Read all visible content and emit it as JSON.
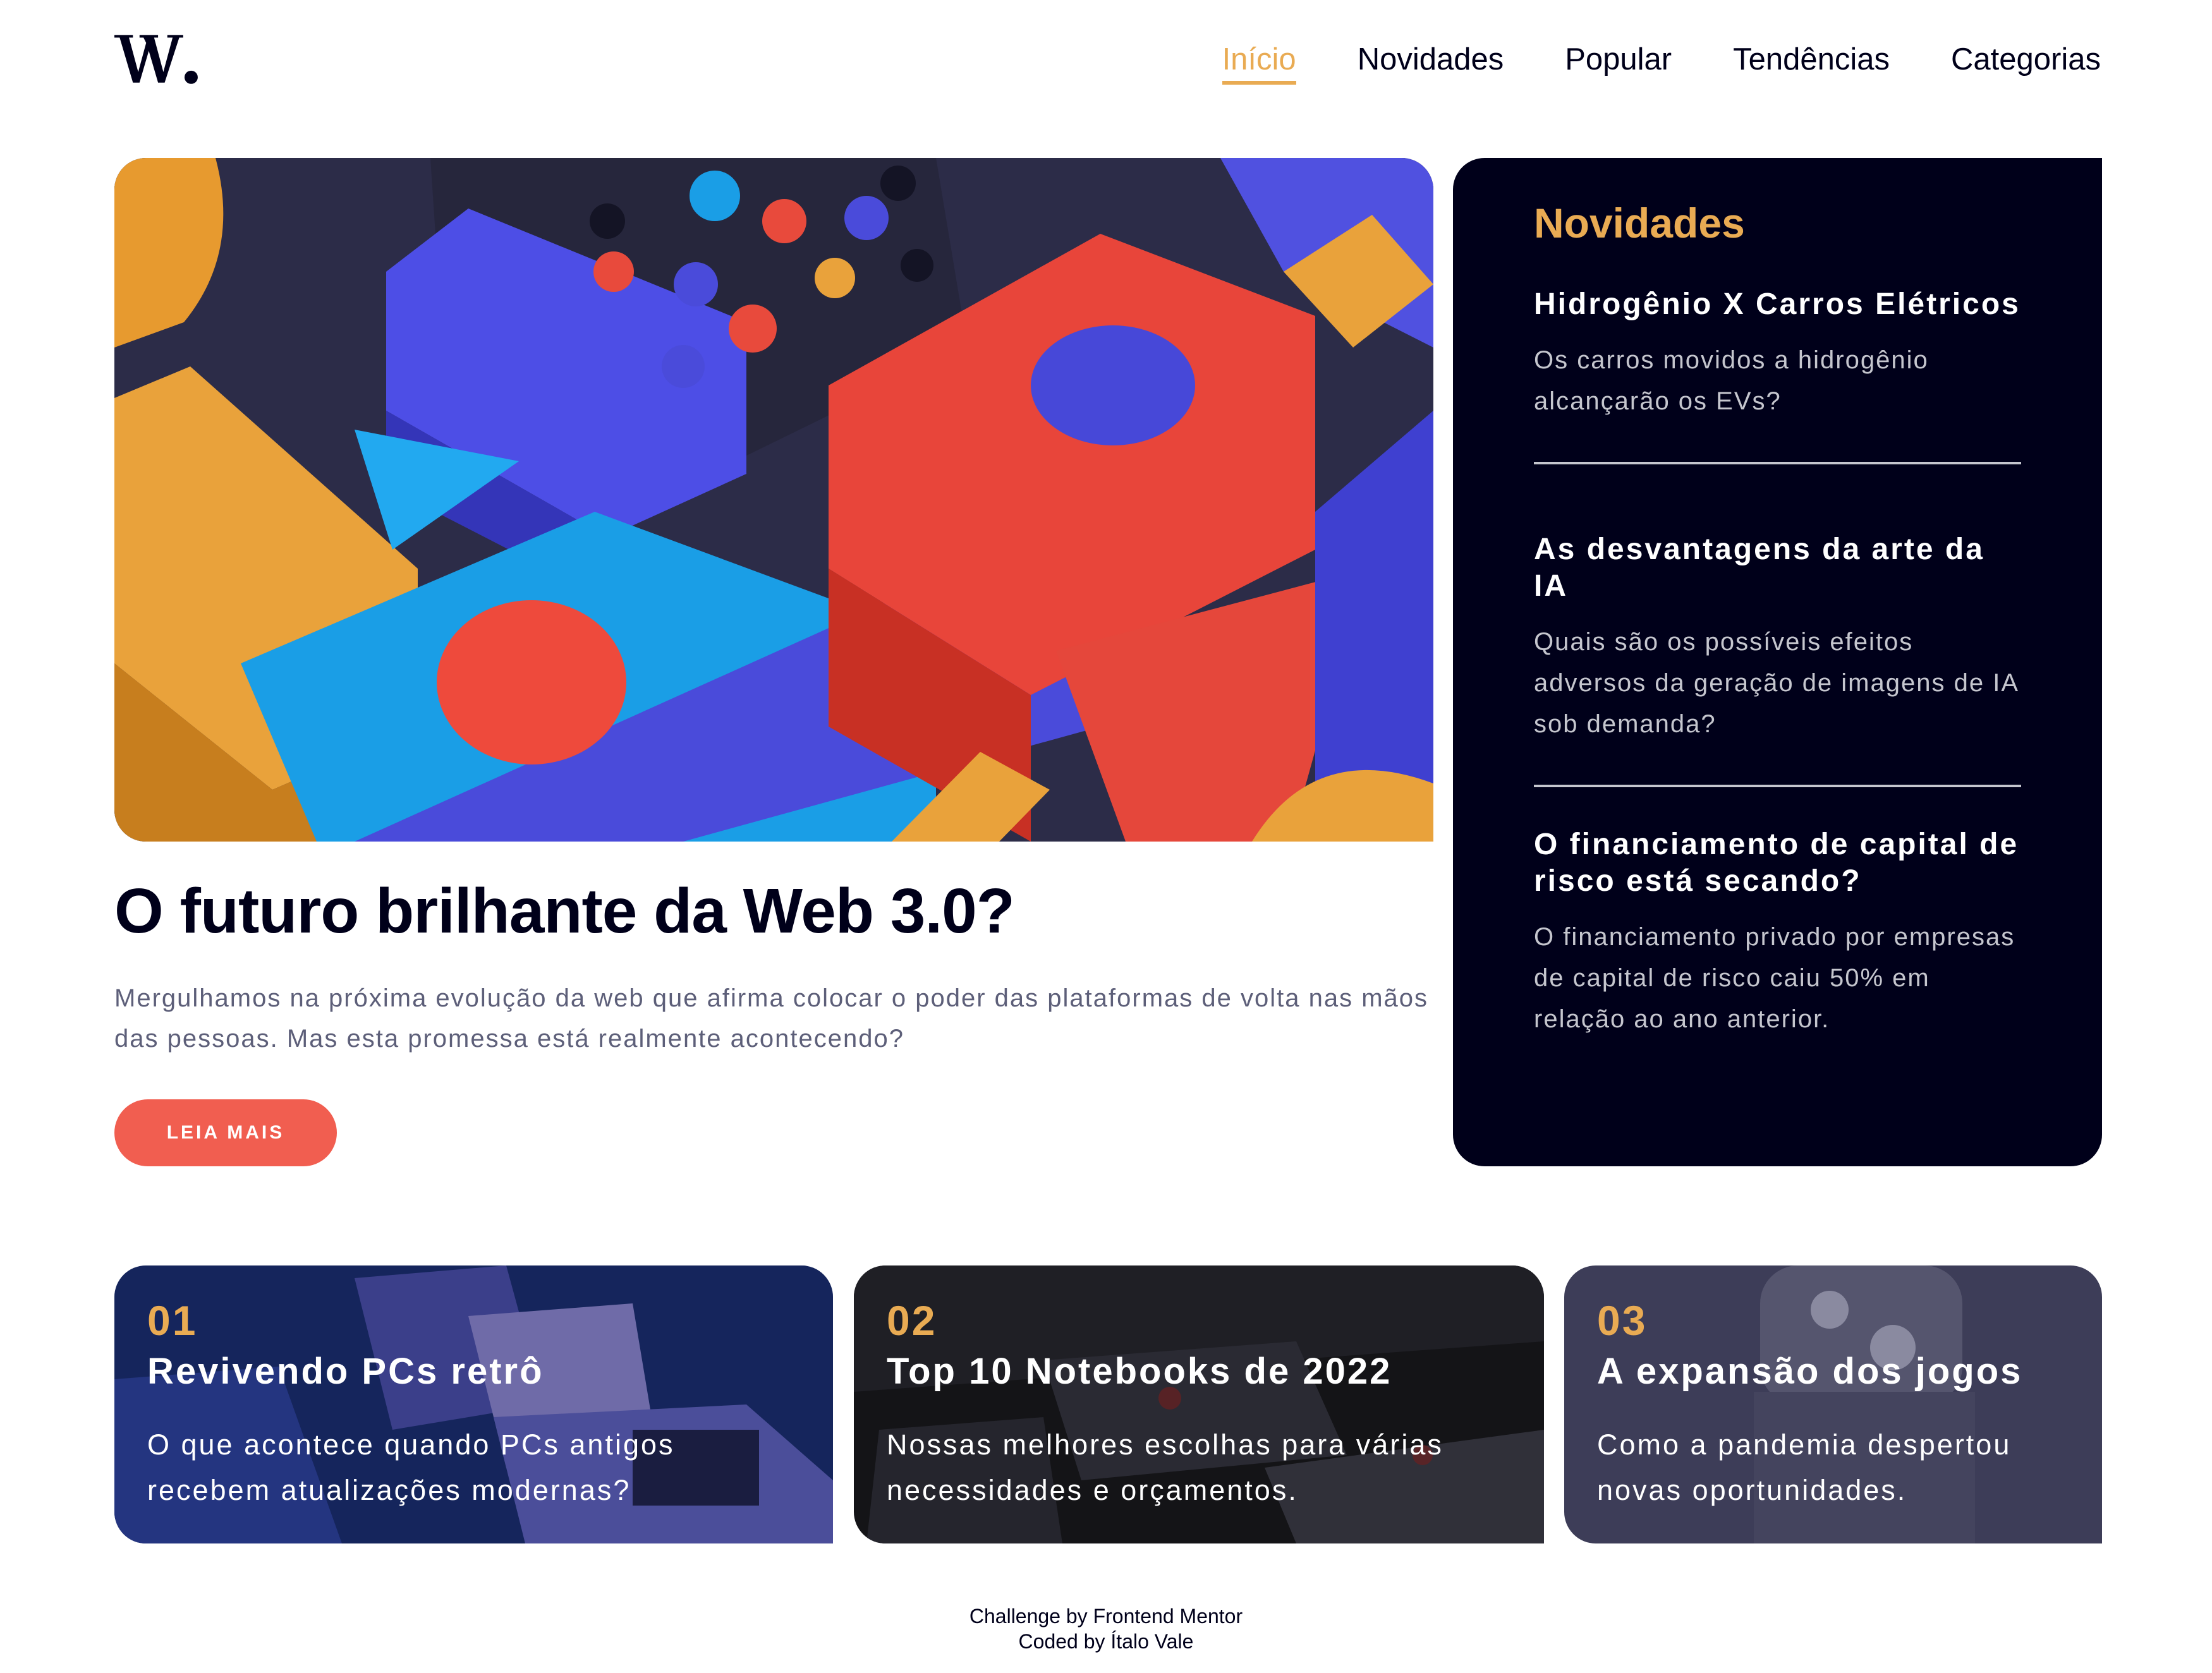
{
  "header": {
    "logo_alt": "W.",
    "nav": [
      {
        "label": "Início",
        "active": true
      },
      {
        "label": "Novidades",
        "active": false
      },
      {
        "label": "Popular",
        "active": false
      },
      {
        "label": "Tendências",
        "active": false
      },
      {
        "label": "Categorias",
        "active": false
      }
    ]
  },
  "hero": {
    "title": "O futuro brilhante da Web 3.0?",
    "description": "Mergulhamos na próxima evolução da web que afirma colocar o poder das plataformas de volta nas mãos das pessoas. Mas esta promessa está realmente acontecendo?",
    "button_label": "LEIA MAIS"
  },
  "news": {
    "heading": "Novidades",
    "items": [
      {
        "title": "Hidrogênio X Carros Elétricos",
        "description": "Os carros movidos a hidrogênio alcançarão os EVs?"
      },
      {
        "title": "As desvantagens da arte da IA",
        "description": "Quais são os possíveis efeitos adversos da geração de imagens de IA sob demanda?"
      },
      {
        "title": "O financiamento de capital de risco está secando?",
        "description": "O financiamento privado por empresas de capital de risco caiu 50% em relação ao ano anterior."
      }
    ]
  },
  "cards": [
    {
      "number": "01",
      "title": "Revivendo PCs retrô",
      "description": "O que acontece quando PCs antigos recebem atualizações modernas?"
    },
    {
      "number": "02",
      "title": "Top 10 Notebooks de 2022",
      "description": "Nossas melhores escolhas para várias necessidades e orçamentos."
    },
    {
      "number": "03",
      "title": "A expansão dos jogos",
      "description": "Como a pandemia despertou novas oportunidades."
    }
  ],
  "footer": {
    "line1": "Challenge by Frontend Mentor",
    "line2": "Coded by Ítalo Vale"
  },
  "colors": {
    "accent": "#e9ab53",
    "button": "#f15e50",
    "dark": "#00001a",
    "muted": "#5d5f79"
  }
}
